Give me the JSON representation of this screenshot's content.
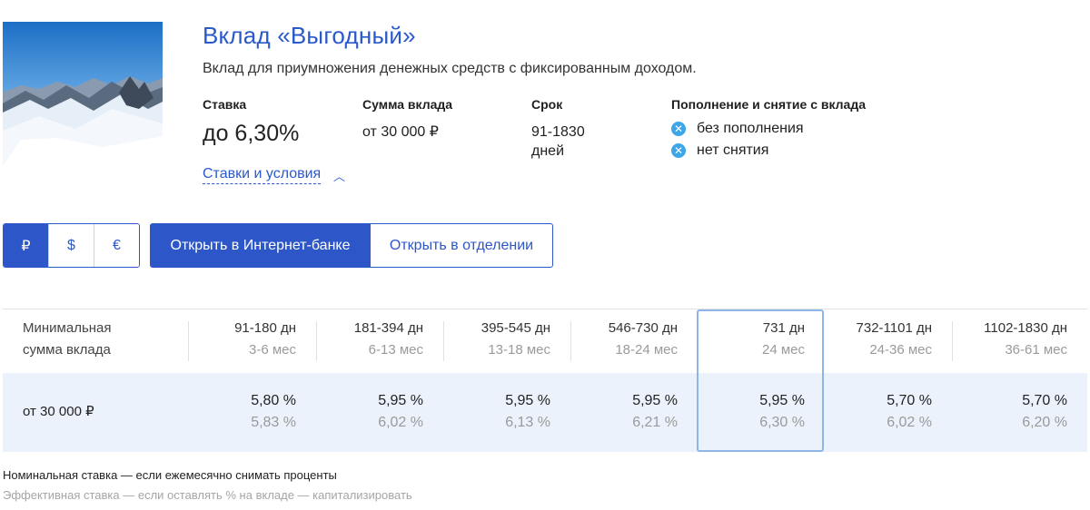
{
  "product": {
    "title": "Вклад «Выгодный»",
    "subtitle": "Вклад для приумножения денежных средств с фиксированным доходом."
  },
  "params": {
    "rate_label": "Ставка",
    "rate_value": "до 6,30%",
    "sum_label": "Сумма вклада",
    "sum_value": "от 30 000 ₽",
    "term_label": "Срок",
    "term_value": "91-1830 дней",
    "topup_label": "Пополнение и снятие с вклада",
    "topup_options": [
      {
        "icon": "cross-circle-icon",
        "text": "без пополнения"
      },
      {
        "icon": "cross-circle-icon",
        "text": "нет снятия"
      }
    ]
  },
  "conditions_link": "Ставки и условия",
  "currencies": [
    {
      "symbol": "₽",
      "active": true
    },
    {
      "symbol": "$",
      "active": false
    },
    {
      "symbol": "€",
      "active": false
    }
  ],
  "actions": {
    "open_online": "Открыть в Интернет-банке",
    "open_branch": "Открыть в отделении"
  },
  "table": {
    "first_header": [
      "Минимальная",
      "сумма вклада"
    ],
    "columns": [
      {
        "days": "91-180 дн",
        "months": "3-6 мес"
      },
      {
        "days": "181-394 дн",
        "months": "6-13 мес"
      },
      {
        "days": "395-545 дн",
        "months": "13-18 мес"
      },
      {
        "days": "546-730 дн",
        "months": "18-24 мес"
      },
      {
        "days": "731 дн",
        "months": "24 мес"
      },
      {
        "days": "732-1101 дн",
        "months": "24-36 мес"
      },
      {
        "days": "1102-1830 дн",
        "months": "36-61 мес"
      }
    ],
    "row_label": "от 30 000 ₽",
    "nominal": [
      "5,80  %",
      "5,95  %",
      "5,95  %",
      "5,95  %",
      "5,95  %",
      "5,70  %",
      "5,70  %"
    ],
    "effective": [
      "5,83  %",
      "6,02  %",
      "6,13  %",
      "6,21  %",
      "6,30  %",
      "6,02  %",
      "6,20  %"
    ],
    "highlighted_column": 4
  },
  "footnotes": {
    "nominal": "Номинальная ставка — если ежемесячно снимать проценты",
    "effective": "Эффективная ставка — если оставлять % на вкладе — капитализировать"
  },
  "colors": {
    "accent": "#2d57c8",
    "title": "#2a59c9",
    "row_bg": "#ecf2fb",
    "highlight_border": "#8fb5e8",
    "icon": "#3ea5e6"
  }
}
